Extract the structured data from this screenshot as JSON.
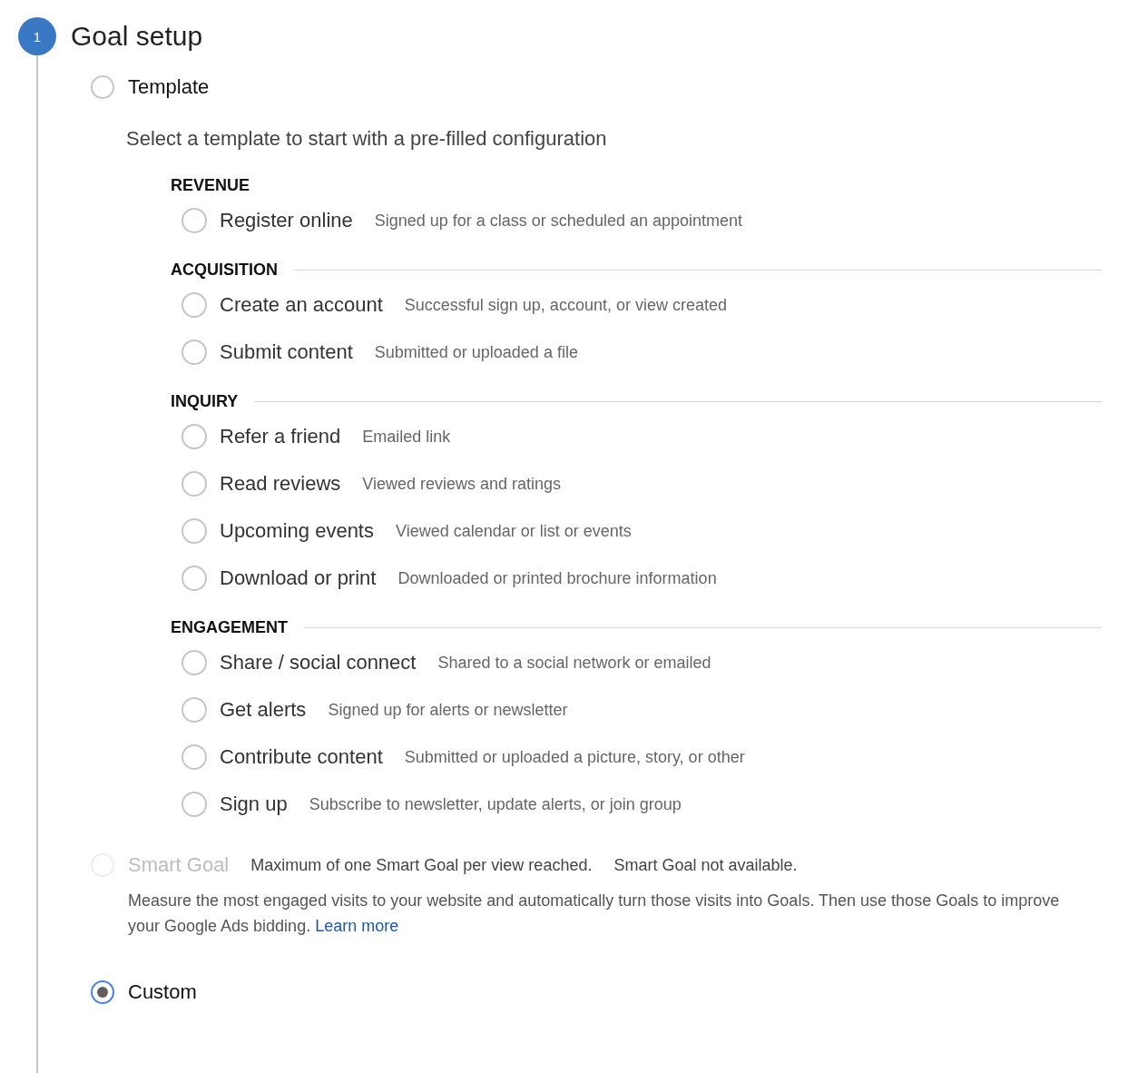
{
  "step": {
    "number": "1",
    "title": "Goal setup"
  },
  "options": [
    {
      "kind": "template",
      "label": "Template",
      "selected": false,
      "disabled": false,
      "description": "Select a template to start with a pre-filled configuration",
      "categories": [
        {
          "title": "REVENUE",
          "items": [
            {
              "label": "Register online",
              "description": "Signed up for a class or scheduled an appointment",
              "selected": false
            }
          ]
        },
        {
          "title": "ACQUISITION",
          "items": [
            {
              "label": "Create an account",
              "description": "Successful sign up, account, or view created",
              "selected": false
            },
            {
              "label": "Submit content",
              "description": "Submitted or uploaded a file",
              "selected": false
            }
          ]
        },
        {
          "title": "INQUIRY",
          "items": [
            {
              "label": "Refer a friend",
              "description": "Emailed link",
              "selected": false
            },
            {
              "label": "Read reviews",
              "description": "Viewed reviews and ratings",
              "selected": false
            },
            {
              "label": "Upcoming events",
              "description": "Viewed calendar or list or events",
              "selected": false
            },
            {
              "label": "Download or print",
              "description": "Downloaded or printed brochure information",
              "selected": false
            }
          ]
        },
        {
          "title": "ENGAGEMENT",
          "items": [
            {
              "label": "Share / social connect",
              "description": "Shared to a social network or emailed",
              "selected": false
            },
            {
              "label": "Get alerts",
              "description": "Signed up for alerts or newsletter",
              "selected": false
            },
            {
              "label": "Contribute content",
              "description": "Submitted or uploaded a picture, story, or other",
              "selected": false
            },
            {
              "label": "Sign up",
              "description": "Subscribe to newsletter, update alerts, or join group",
              "selected": false
            }
          ]
        }
      ]
    },
    {
      "kind": "smart",
      "label": "Smart Goal",
      "selected": false,
      "disabled": true,
      "notes": [
        "Maximum of one Smart Goal per view reached.",
        "Smart Goal not available."
      ],
      "description": "Measure the most engaged visits to your website and automatically turn those visits into Goals. Then use those Goals to improve your Google Ads bidding.",
      "link": "Learn more"
    },
    {
      "kind": "custom",
      "label": "Custom",
      "selected": true,
      "disabled": false
    }
  ]
}
